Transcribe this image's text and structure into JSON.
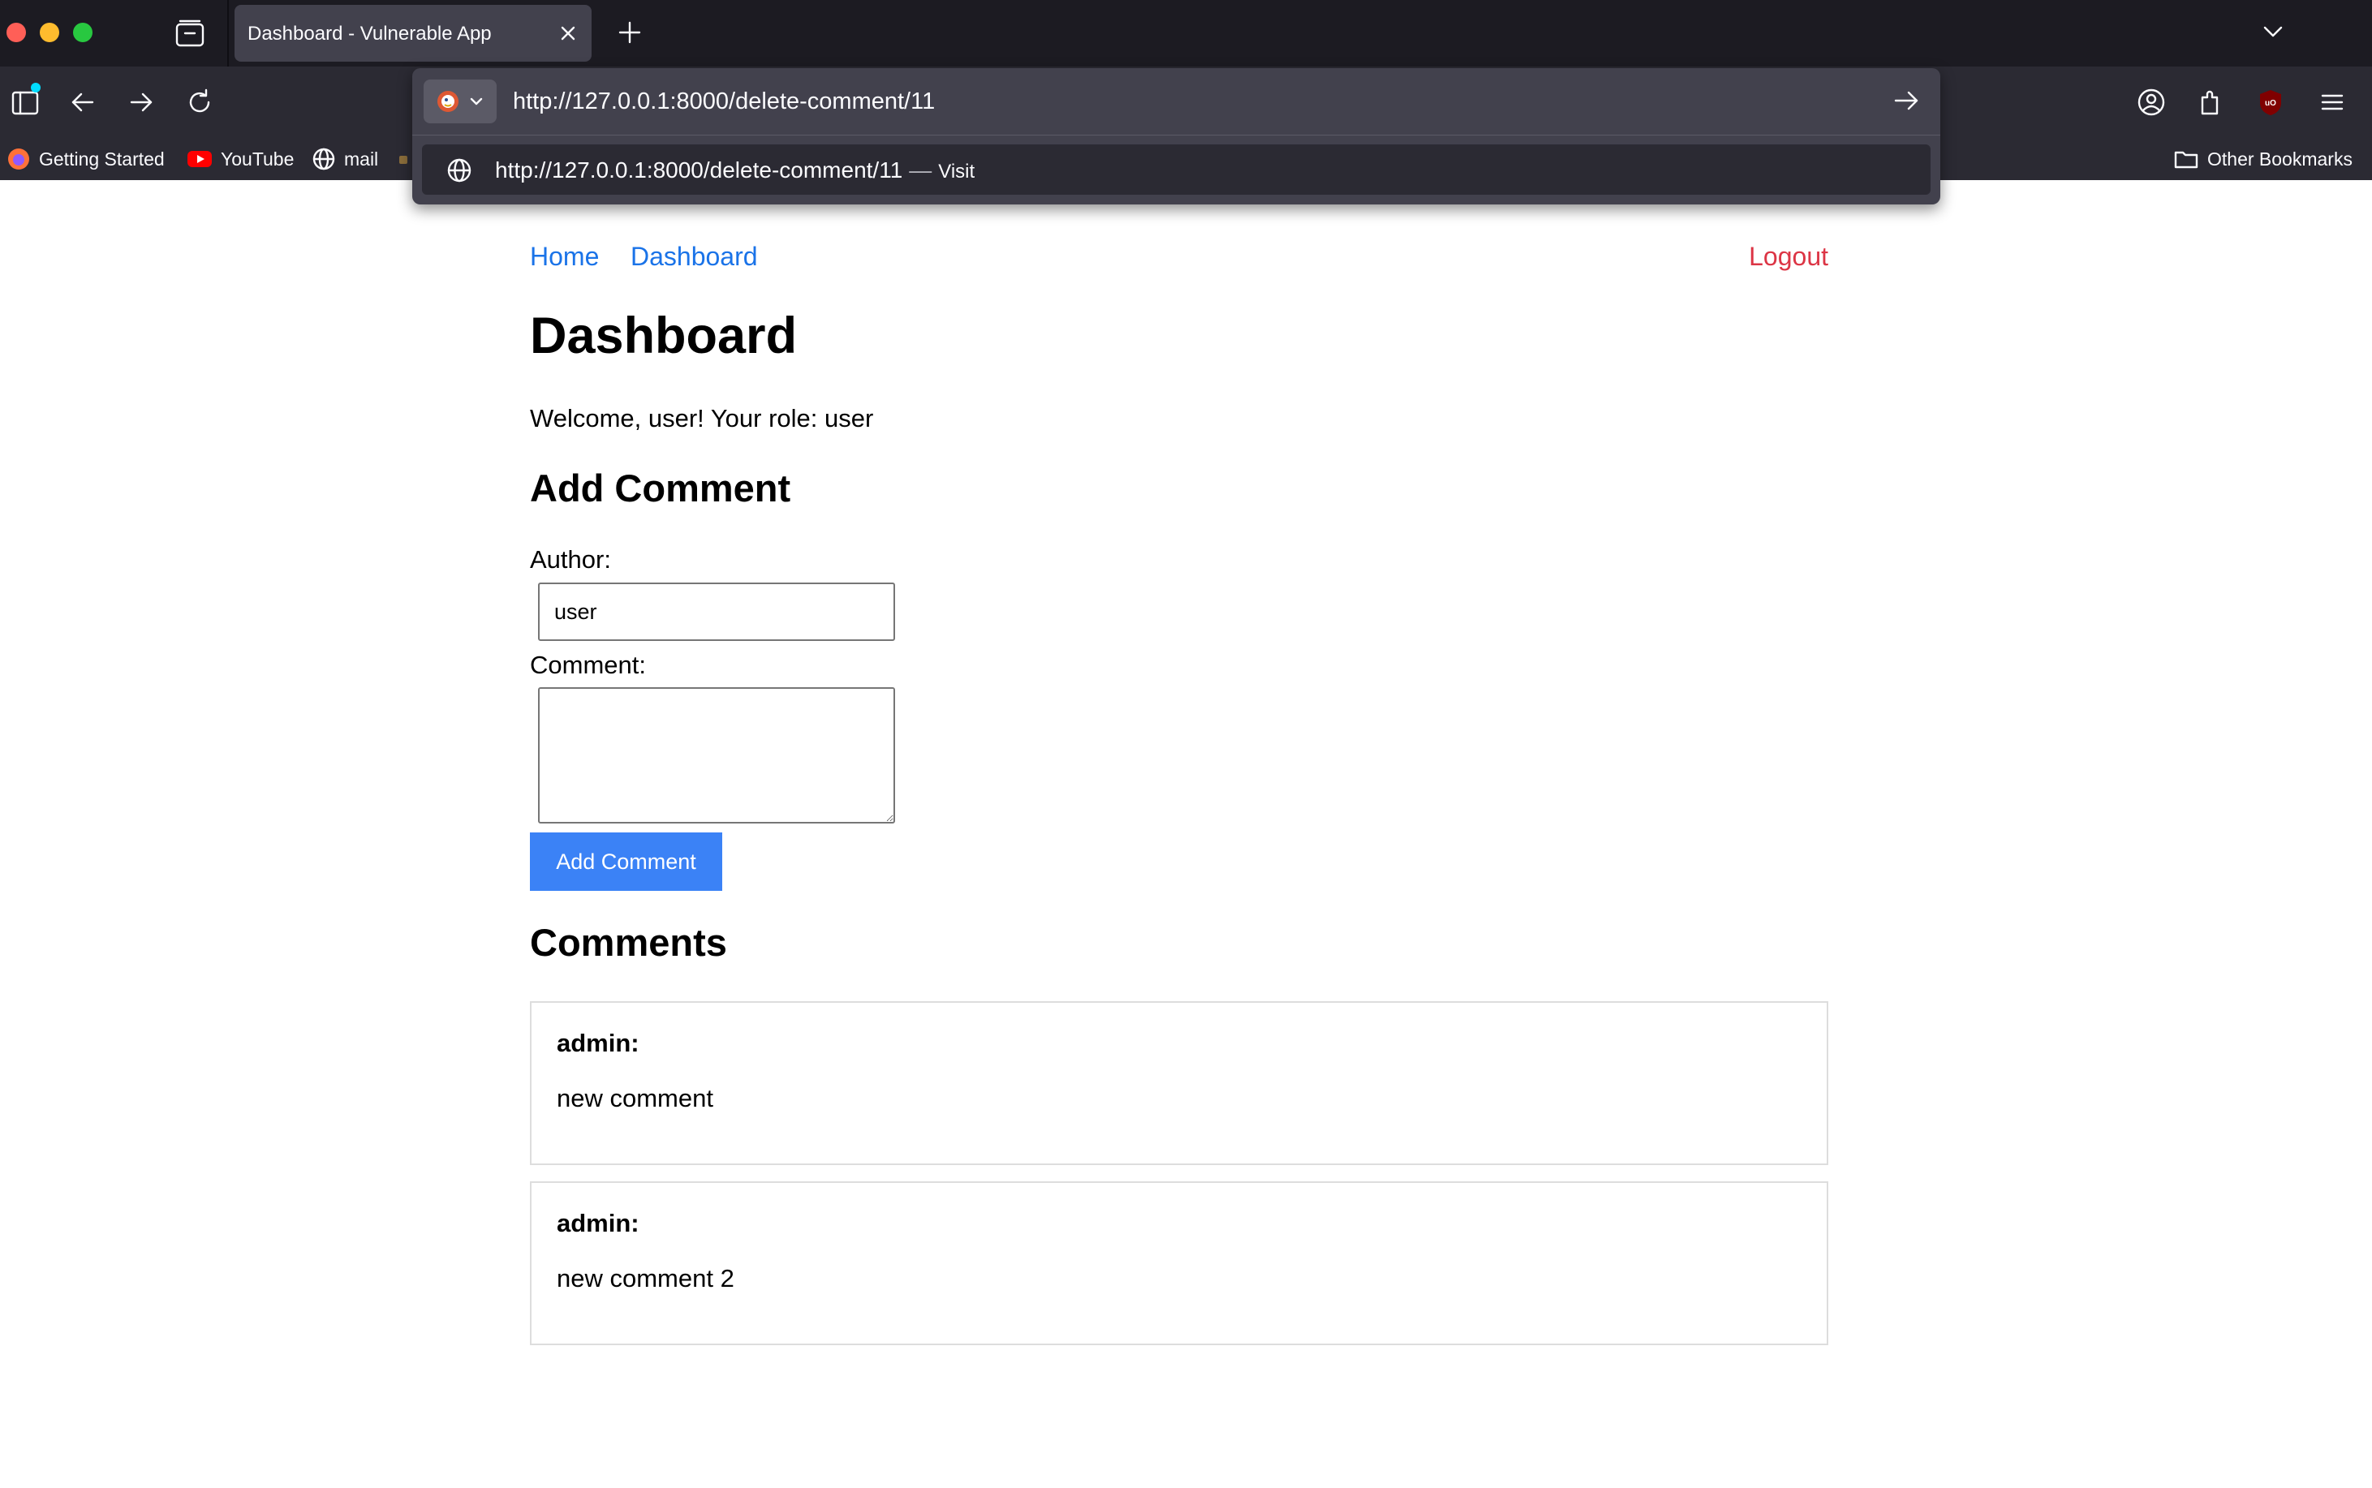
{
  "browser": {
    "tab_title": "Dashboard - Vulnerable App",
    "url": "http://127.0.0.1:8000/delete-comment/11",
    "suggestion": {
      "url": "http://127.0.0.1:8000/delete-comment/11",
      "separator": "—",
      "action": "Visit"
    },
    "bookmarks": [
      {
        "label": "Getting Started",
        "icon": "firefox-icon"
      },
      {
        "label": "YouTube",
        "icon": "youtube-icon"
      },
      {
        "label": "mail",
        "icon": "globe-icon"
      },
      {
        "label": "",
        "icon": "bookmark-favicon"
      }
    ],
    "other_bookmarks": "Other Bookmarks",
    "accent_colors": {
      "youtube": "#ff0000",
      "ublock": "#800000",
      "sidebar_dot": "#00ddff"
    }
  },
  "page": {
    "nav": {
      "home": "Home",
      "dashboard": "Dashboard",
      "logout": "Logout"
    },
    "title": "Dashboard",
    "welcome": "Welcome, user! Your role: user",
    "add_comment": {
      "heading": "Add Comment",
      "author_label": "Author:",
      "author_value": "user",
      "comment_label": "Comment:",
      "comment_value": "",
      "submit_label": "Add Comment"
    },
    "comments_heading": "Comments",
    "comments": [
      {
        "author": "admin:",
        "text": "new comment"
      },
      {
        "author": "admin:",
        "text": "new comment 2"
      }
    ],
    "colors": {
      "link": "#1a73e8",
      "logout": "#dc3545",
      "button": "#3b82f6"
    }
  }
}
